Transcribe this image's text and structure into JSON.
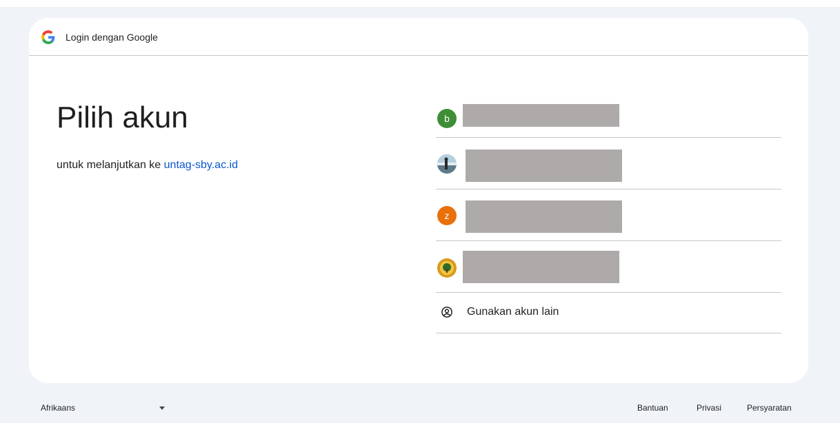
{
  "header": {
    "title": "Login dengan Google",
    "logo_icon": "google-g-icon"
  },
  "main": {
    "headline": "Pilih akun",
    "subtitle_prefix": "untuk melanjutkan ke",
    "subtitle_link": "untag-sby.ac.id"
  },
  "accounts": [
    {
      "avatar_letter": "b",
      "avatar_color": "#3e8e35",
      "avatar_icon": "letter-avatar"
    },
    {
      "avatar_letter": "",
      "avatar_color": "#9cb7c9",
      "avatar_icon": "photo-avatar-icon"
    },
    {
      "avatar_letter": "z",
      "avatar_color": "#e8710a",
      "avatar_icon": "letter-avatar"
    },
    {
      "avatar_letter": "",
      "avatar_color": "#d99a1e",
      "avatar_icon": "emblem-avatar-icon"
    }
  ],
  "other_account": {
    "label": "Gunakan akun lain",
    "icon": "account-circle-icon"
  },
  "footer": {
    "language": "Afrikaans",
    "links": [
      "Bantuan",
      "Privasi",
      "Persyaratan"
    ]
  },
  "colors": {
    "link": "#0b57d0",
    "background": "#f0f4f9",
    "divider": "#c4c7c5",
    "redaction": "#aeaaaa"
  }
}
